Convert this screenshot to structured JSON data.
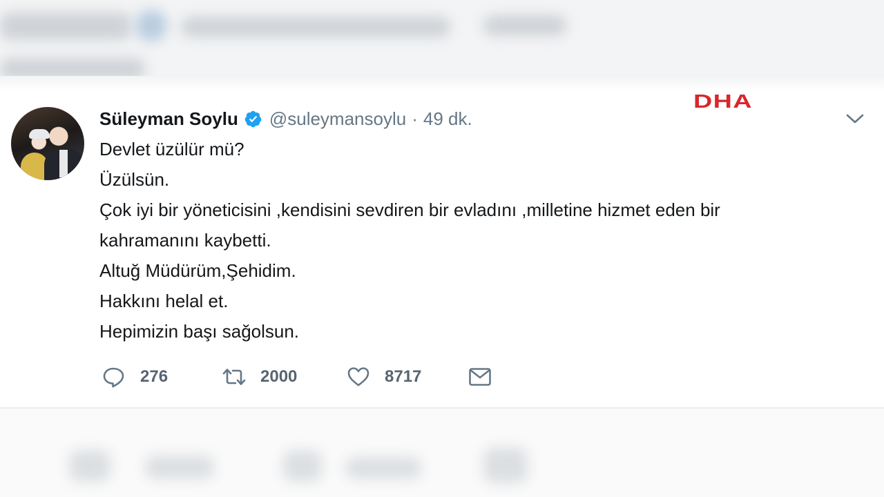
{
  "tweet": {
    "author_name": "Süleyman Soylu",
    "handle": "@suleymansoylu",
    "separator": "·",
    "time": "49 dk.",
    "lines": [
      "Devlet üzülür mü?",
      "Üzülsün.",
      "Çok iyi bir yöneticisini ,kendisini sevdiren bir evladını ,milletine hizmet eden bir",
      "kahramanını kaybetti.",
      "Altuğ Müdürüm,Şehidim.",
      "Hakkını helal et.",
      "Hepimizin başı sağolsun."
    ],
    "replies": "276",
    "retweets": "2000",
    "likes": "8717"
  },
  "watermark": "DHA",
  "icons": {
    "verified": "verified-badge-icon",
    "caret": "chevron-down-icon",
    "reply": "reply-icon",
    "retweet": "retweet-icon",
    "like": "heart-icon",
    "dm": "envelope-icon"
  },
  "colors": {
    "verified_blue": "#1da1f2",
    "watermark_red": "#d9262b",
    "muted_text": "#657786"
  }
}
